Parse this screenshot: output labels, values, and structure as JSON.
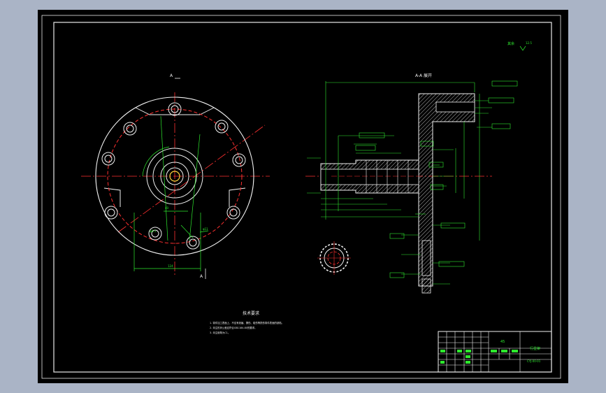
{
  "drawing": {
    "section_label_left": "A",
    "section_label_left_bottom": "A",
    "section_label_right": "A-A  展开",
    "roughness_note": "其余",
    "roughness_value": "12.5"
  },
  "technical_requirements": {
    "title": "技术要求",
    "items": [
      "1. 零件加工表面上，不应有划痕、擦伤、碰伤等损伤零件表面的缺陷。",
      "2. 未注形状公差应符合GB1184-80的要求。",
      "3. 未注倒角为C1。"
    ]
  },
  "title_block": {
    "part_name": "行星架",
    "material": "45",
    "drawing_no": "CYJ-00-01"
  }
}
